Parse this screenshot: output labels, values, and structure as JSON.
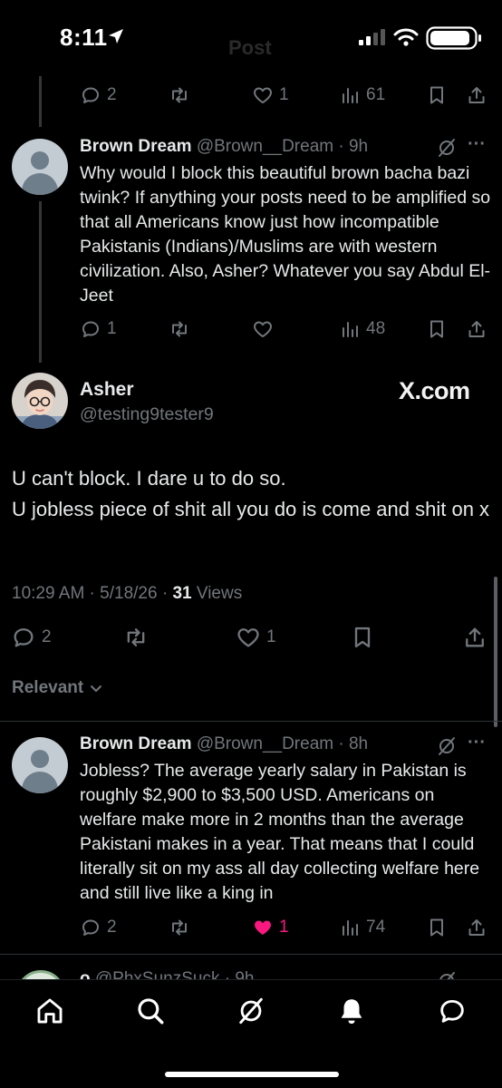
{
  "status_bar": {
    "time": "8:11"
  },
  "header": {
    "ghost_title": "Post"
  },
  "top_actions": {
    "replies": "2",
    "likes": "1",
    "views": "61"
  },
  "reply1": {
    "name": "Brown Dream",
    "handle_time": "@Brown__Dream · 9h",
    "text": "Why would I block this beautiful brown bacha bazi twink? If anything your posts need to be amplified so that all Americans know just how incompatible Pakistanis (Indians)/Muslims are with western civilization. Also, Asher? Whatever you say Abdul El-Jeet",
    "replies": "1",
    "views": "48",
    "more": "···"
  },
  "main_post": {
    "name": "Asher",
    "handle": "@testing9tester9",
    "watermark": "X.com",
    "line1": "U can't block. I dare u to do so.",
    "line2": "U jobless piece of shit all you do is come and shit on x",
    "timestamp": "10:29 AM · 5/18/26 · ",
    "views_count": "31",
    "views_label": " Views",
    "replies": "2",
    "likes": "1"
  },
  "sort": {
    "label": "Relevant"
  },
  "reply2": {
    "name": "Brown Dream",
    "handle_time": "@Brown__Dream · 8h",
    "text": "Jobless? The average yearly salary in Pakistan is roughly $2,900 to $3,500 USD. Americans on welfare make more in 2 months than the average Pakistani makes in a year. That means that I could literally sit on my ass all day collecting welfare here and still live like a king in",
    "replies": "2",
    "likes": "1",
    "views": "74",
    "more": "···",
    "like_color": "#f91880"
  },
  "reply3": {
    "name": "o",
    "handle_time": "@PhxSunzSuck · 9h"
  },
  "nav": [
    "home-icon",
    "search-icon",
    "grok-icon",
    "notifications-icon",
    "messages-icon"
  ]
}
